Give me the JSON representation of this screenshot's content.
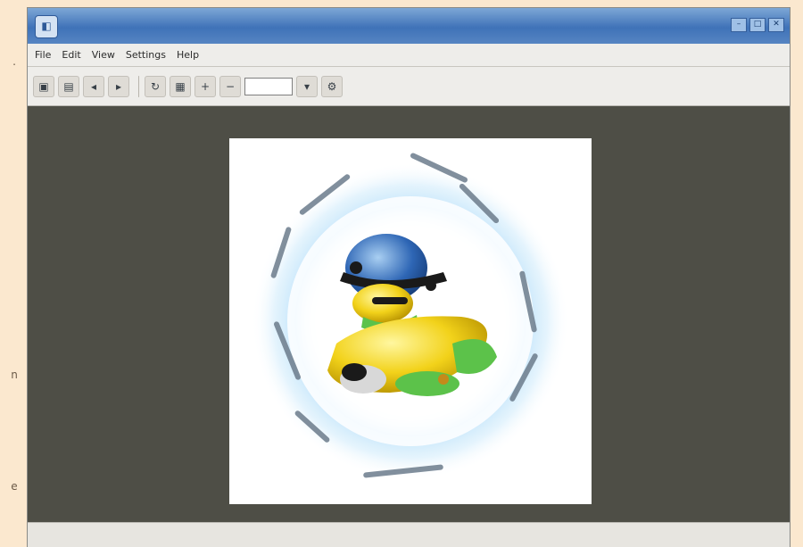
{
  "app": {
    "window_title": "",
    "icon": "app-icon"
  },
  "page_marks": [
    ".",
    "n",
    "e"
  ],
  "menu": [
    {
      "label": "File"
    },
    {
      "label": "Edit"
    },
    {
      "label": "View"
    },
    {
      "label": "Settings"
    },
    {
      "label": "Help"
    }
  ],
  "toolbar": {
    "zoom_value": ""
  },
  "image": {
    "ring_text": "",
    "colors": {
      "ring": "#bfe3fa",
      "helmet": "#2e66b5",
      "body": "#f2d21a",
      "accent_green": "#5cc24a",
      "canvas_bg": "#4e4e46"
    }
  },
  "status": {
    "text": ""
  }
}
